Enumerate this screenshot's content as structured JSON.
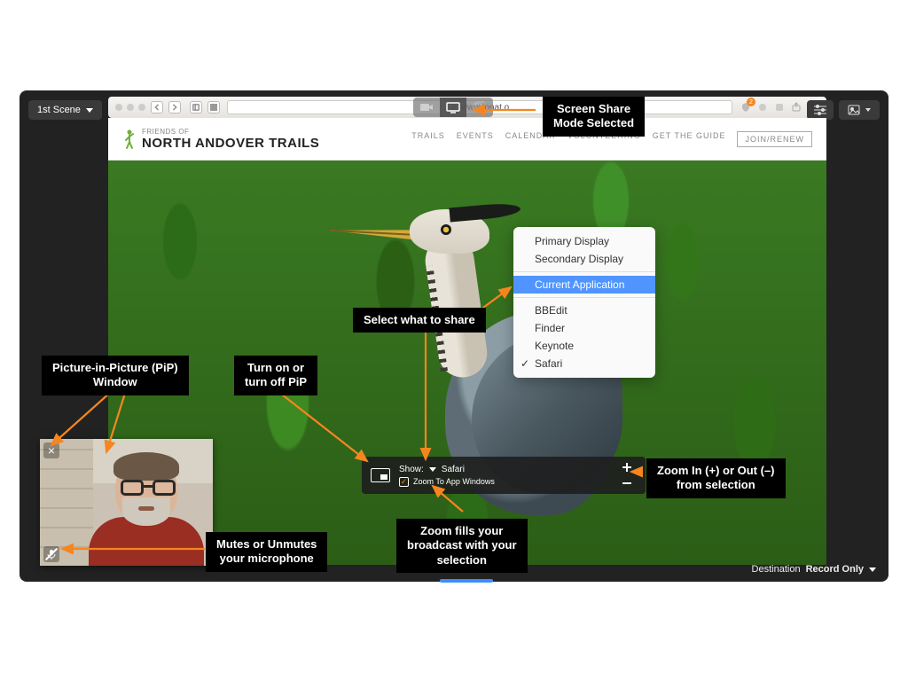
{
  "toolbar": {
    "scene_label": "1st Scene",
    "url": "www.fonat.o"
  },
  "browser_badge": "2",
  "site": {
    "logo_small": "FRIENDS OF",
    "logo_big": "NORTH ANDOVER TRAILS",
    "nav": [
      "TRAILS",
      "EVENTS",
      "CALENDAR",
      "VOLUNTEERING",
      "GET THE GUIDE"
    ],
    "join": "JOIN/RENEW"
  },
  "share_menu": {
    "items": [
      {
        "label": "Primary Display"
      },
      {
        "label": "Secondary Display"
      },
      {
        "label": "Current Application",
        "selected": true
      },
      {
        "label": "BBEdit"
      },
      {
        "label": "Finder"
      },
      {
        "label": "Keynote"
      },
      {
        "label": "Safari",
        "checked": true
      }
    ]
  },
  "ctrl": {
    "show_label": "Show:",
    "show_value": "Safari",
    "zoom_chk": "Zoom To App Windows"
  },
  "dest": {
    "label": "Destination",
    "value": "Record Only"
  },
  "callouts": {
    "screen_share": "Screen Share\nMode Selected",
    "pip": "Picture-in-Picture (PiP)\nWindow",
    "pip_toggle": "Turn on or\nturn off PiP",
    "select_share": "Select what to share",
    "zoom_fill": "Zoom fills your\nbroadcast with your\nselection",
    "zoom_io": "Zoom In (+) or Out (–)\nfrom selection",
    "mute": "Mutes or Unmutes\nyour microphone"
  }
}
